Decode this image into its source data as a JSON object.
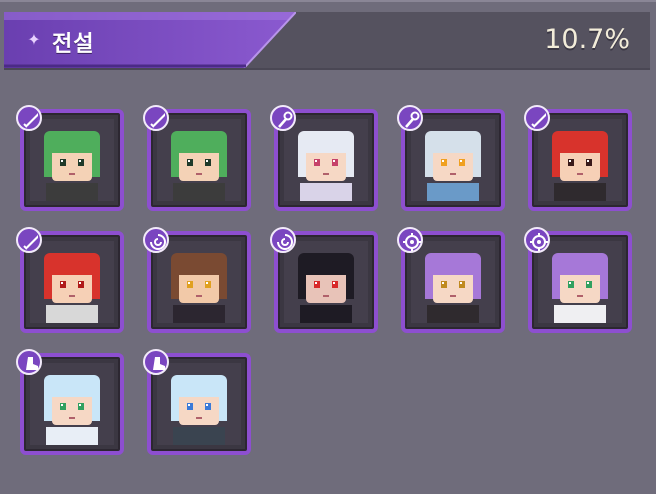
{
  "header": {
    "tab_label": "전설",
    "completion": "10.7%"
  },
  "colors": {
    "card_border": "#8d4fd0",
    "tab_fill": "#7a4cc0",
    "badge_fill": "#7a46c0"
  },
  "characters": [
    {
      "class_icon": "sword-icon",
      "hair": "#4fae5c",
      "skin": "#f4d2b6",
      "outfit": "#3c3c3c",
      "eyes": "#1f3a2a"
    },
    {
      "class_icon": "sword-icon",
      "hair": "#4fae5c",
      "skin": "#f4d2b6",
      "outfit": "#3c3c3c",
      "eyes": "#1f3a2a"
    },
    {
      "class_icon": "staff-icon",
      "hair": "#e6eaf3",
      "skin": "#f6d8c5",
      "outfit": "#d9d3e8",
      "eyes": "#c6426a"
    },
    {
      "class_icon": "staff-icon",
      "hair": "#d5e0ea",
      "skin": "#f6d8c5",
      "outfit": "#6a9ac8",
      "eyes": "#f0a020"
    },
    {
      "class_icon": "sword-icon",
      "hair": "#d8332c",
      "skin": "#f6d0b6",
      "outfit": "#2f2a2e",
      "eyes": "#3a1a1a"
    },
    {
      "class_icon": "sword-icon",
      "hair": "#d8332c",
      "skin": "#f6d0b6",
      "outfit": "#d8d8d8",
      "eyes": "#b01a1a"
    },
    {
      "class_icon": "swirl-icon",
      "hair": "#7a4a32",
      "skin": "#f2c9a8",
      "outfit": "#2c2630",
      "eyes": "#e0a020"
    },
    {
      "class_icon": "swirl-icon",
      "hair": "#1e1b24",
      "skin": "#e8c3b8",
      "outfit": "#1e1b24",
      "eyes": "#d82a2a"
    },
    {
      "class_icon": "gear-icon",
      "hair": "#a678d8",
      "skin": "#f6d8c5",
      "outfit": "#2f2a2e",
      "eyes": "#c08a20"
    },
    {
      "class_icon": "gear-icon",
      "hair": "#a678d8",
      "skin": "#f6d8c5",
      "outfit": "#efeff2",
      "eyes": "#30a060"
    },
    {
      "class_icon": "boot-icon",
      "hair": "#c9e6f8",
      "skin": "#f6d8c5",
      "outfit": "#e8eef6",
      "eyes": "#30a060"
    },
    {
      "class_icon": "boot-icon",
      "hair": "#c9e6f8",
      "skin": "#f6d8c5",
      "outfit": "#3a4450",
      "eyes": "#3a7ad8"
    }
  ]
}
